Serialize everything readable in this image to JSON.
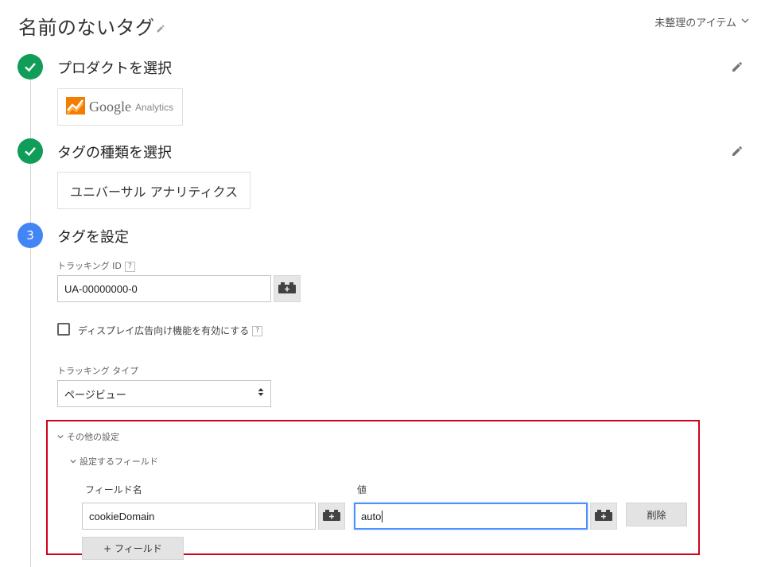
{
  "header": {
    "title": "名前のないタグ",
    "uncategorized": "未整理のアイテム"
  },
  "steps": [
    {
      "state": "done",
      "title": "プロダクトを選択"
    },
    {
      "state": "done",
      "title": "タグの種類を選択"
    },
    {
      "state": "active",
      "number": "3",
      "title": "タグを設定"
    }
  ],
  "product": {
    "brand": "Google",
    "sub": "Analytics"
  },
  "tag_type": "ユニバーサル アナリティクス",
  "tracking_id": {
    "label": "トラッキング ID",
    "help": "?",
    "value": "UA-00000000-0"
  },
  "display_features": {
    "label": "ディスプレイ広告向け機能を有効にする",
    "help": "?",
    "checked": false
  },
  "tracking_type": {
    "label": "トラッキング タイプ",
    "value": "ページビュー"
  },
  "more_settings": {
    "label": "その他の設定",
    "fields_section": "設定するフィールド",
    "field_name_header": "フィールド名",
    "value_header": "値",
    "rows": [
      {
        "field": "cookieDomain",
        "value": "auto"
      }
    ],
    "delete_label": "削除",
    "add_field_label": "+ フィールド"
  },
  "colors": {
    "check": "#0f9d58",
    "step_active": "#4285f4",
    "highlight": "#d0021b",
    "focus": "#4d90fe"
  }
}
